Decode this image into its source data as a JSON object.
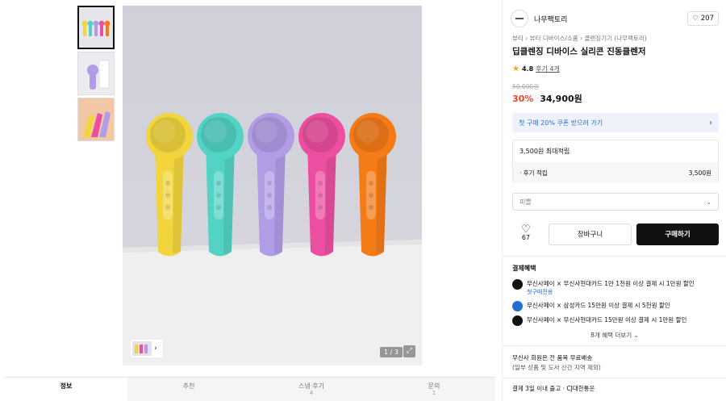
{
  "colors": {
    "accent_red": "#f0422b",
    "link_blue": "#2a6ad8",
    "buy_button": "#111111",
    "product_colors": [
      "#f2d53c",
      "#52d3c3",
      "#b19ce6",
      "#ec4f9f",
      "#f57b17"
    ]
  },
  "gallery": {
    "thumbnails": [
      "thumb-colorful-five",
      "thumb-purple-box",
      "thumb-three-colors"
    ],
    "active_index": 0,
    "pager": "1 / 3"
  },
  "tabs": [
    {
      "label": "정보",
      "count": ""
    },
    {
      "label": "추천",
      "count": ""
    },
    {
      "label": "스냅·후기",
      "count": "4"
    },
    {
      "label": "문의",
      "count": "1"
    }
  ],
  "brand": {
    "name": "나무팩토리",
    "likes": "207"
  },
  "breadcrumb": {
    "c1": "뷰티",
    "c2": "뷰티 디바이스/소품",
    "c3": "클렌징기기 (나무팩토리)"
  },
  "product": {
    "title": "딥클렌징 디바이스 실리콘 진동클렌저",
    "rating": "4.8",
    "review_link": "후기 4개",
    "original_price": "50,000원",
    "discount": "30%",
    "price": "34,900원"
  },
  "coupon": {
    "text": "첫 구매 20% 쿠폰 받으러 가기"
  },
  "points": {
    "head": "3,500원 최대적립",
    "row_label": "· 후기 적립",
    "row_value": "3,500원"
  },
  "option": {
    "placeholder": "피쁠"
  },
  "actions": {
    "like_count": "67",
    "cart_label": "장바구니",
    "buy_label": "구매하기"
  },
  "payment": {
    "title": "결제혜택",
    "items": [
      {
        "text": "무신사페이 × 무신사현대카드 1만 1천원 이상 결제 시 1만원 할인",
        "tag": "첫구매전용",
        "icon_color": "#111111"
      },
      {
        "text": "무신사페이 × 삼성카드 15만원 이상 결제 시 5천원 할인",
        "tag": "",
        "icon_color": "#1f6fd0"
      },
      {
        "text": "무신사페이 × 무신사현대카드 15만원 이상 결제 시 1만원 할인",
        "tag": "",
        "icon_color": "#111111"
      }
    ],
    "more": "8개 혜택 더보기"
  },
  "shipping": {
    "line1": "무신사 회원은 전 품목 무료배송",
    "line2": "(일부 상품 및 도서 산간 지역 제외)",
    "line3": "결제 3일 이내 출고 · CJ대한통운"
  }
}
